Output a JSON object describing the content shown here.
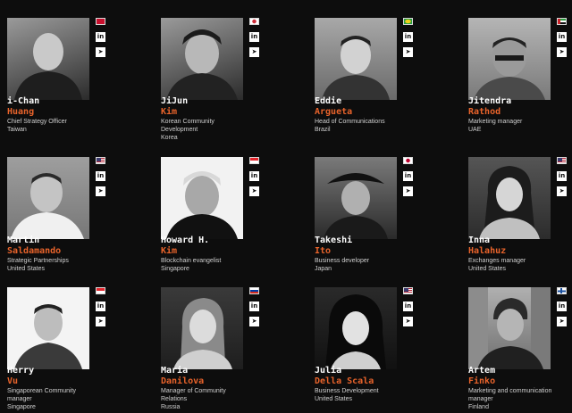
{
  "people": [
    {
      "first": "i-Chan",
      "last": "Huang",
      "role": "Chief Strategy Officer",
      "location": "Taiwan",
      "flag": "taiwan-flag-icon",
      "flag_colors": [
        "#c8102e",
        "#1a3e9b"
      ]
    },
    {
      "first": "JiJun",
      "last": "Kim",
      "role": "Korean Community Development",
      "location": "Korea",
      "flag": "korea-flag-icon",
      "flag_colors": [
        "#ffffff",
        "#cd2e3a"
      ]
    },
    {
      "first": "Eddie",
      "last": "Argueta",
      "role": "Head of Communications",
      "location": "Brazil",
      "flag": "brazil-flag-icon",
      "flag_colors": [
        "#2a9d3f",
        "#f2d31b"
      ]
    },
    {
      "first": "Jitendra",
      "last": "Rathod",
      "role": "Marketing manager",
      "location": "UAE",
      "flag": "uae-flag-icon",
      "flag_colors": [
        "#2a9d3f",
        "#cc2229"
      ]
    },
    {
      "first": "Martin",
      "last": "Saldamando",
      "role": "Strategic Partnerships",
      "location": "United States",
      "flag": "usa-flag-icon",
      "flag_colors": [
        "#b22234",
        "#3c3b6e"
      ]
    },
    {
      "first": "Howard H.",
      "last": "Kim",
      "role": "Blockchain evangelist",
      "location": "Singapore",
      "flag": "singapore-flag-icon",
      "flag_colors": [
        "#e3242b",
        "#ffffff"
      ]
    },
    {
      "first": "Takeshi",
      "last": "Ito",
      "role": "Business developer",
      "location": "Japan",
      "flag": "japan-flag-icon",
      "flag_colors": [
        "#ffffff",
        "#bc002d"
      ]
    },
    {
      "first": "Inna",
      "last": "Halahuz",
      "role": "Exchanges manager",
      "location": "United States",
      "flag": "usa-flag-icon",
      "flag_colors": [
        "#b22234",
        "#3c3b6e"
      ]
    },
    {
      "first": "Herry",
      "last": "Vu",
      "role": "Singaporean Community manager",
      "location": "Singapore",
      "flag": "singapore-flag-icon",
      "flag_colors": [
        "#e3242b",
        "#ffffff"
      ]
    },
    {
      "first": "Maria",
      "last": "Danilova",
      "role": "Manager of Community Relations",
      "location": "Russia",
      "flag": "russia-flag-icon",
      "flag_colors": [
        "#ffffff",
        "#d52b1e"
      ]
    },
    {
      "first": "Julia",
      "last": "Della Scala",
      "role": "Business Development",
      "location": "United States",
      "flag": "usa-flag-icon",
      "flag_colors": [
        "#b22234",
        "#3c3b6e"
      ]
    },
    {
      "first": "Artem",
      "last": "Finko",
      "role": "Marketing and communication manager",
      "location": "Finland",
      "flag": "finland-flag-icon",
      "flag_colors": [
        "#ffffff",
        "#1a4f9e"
      ]
    }
  ],
  "social": {
    "linkedin": "in",
    "telegram": "➤"
  },
  "colors": {
    "background": "#0d0d0d",
    "last_name": "#e8632b"
  }
}
